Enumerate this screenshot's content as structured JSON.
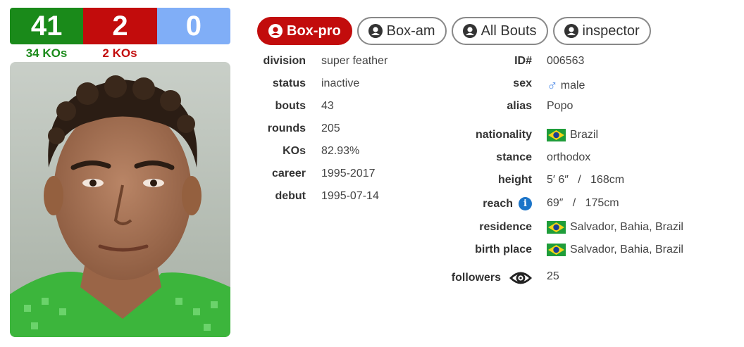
{
  "record": {
    "wins": "41",
    "losses": "2",
    "draws": "0",
    "wins_kos": "34 KOs",
    "losses_kos": "2 KOs"
  },
  "tabs": [
    {
      "label": "Box-pro",
      "active": true
    },
    {
      "label": "Box-am",
      "active": false
    },
    {
      "label": "All Bouts",
      "active": false
    },
    {
      "label": "inspector",
      "active": false
    }
  ],
  "left_info": [
    {
      "label": "division",
      "value": "super feather"
    },
    {
      "label": "status",
      "value": "inactive"
    },
    {
      "label": "bouts",
      "value": "43"
    },
    {
      "label": "rounds",
      "value": "205"
    },
    {
      "label": "KOs",
      "value": "82.93%"
    },
    {
      "label": "career",
      "value": "1995-2017"
    },
    {
      "label": "debut",
      "value": "1995-07-14"
    }
  ],
  "right_info": {
    "id": {
      "label": "ID#",
      "value": "006563"
    },
    "sex": {
      "label": "sex",
      "value": "male",
      "icon": "male-icon"
    },
    "alias": {
      "label": "alias",
      "value": "Popo"
    },
    "nationality": {
      "label": "nationality",
      "value": "Brazil",
      "icon": "brazil-flag-icon"
    },
    "stance": {
      "label": "stance",
      "value": "orthodox"
    },
    "height": {
      "label": "height",
      "value": "5′ 6″   /   168cm"
    },
    "reach": {
      "label": "reach",
      "value": "69″   /   175cm",
      "icon": "info-icon"
    },
    "residence": {
      "label": "residence",
      "value": "Salvador, Bahia, Brazil",
      "icon": "brazil-flag-icon"
    },
    "birth_place": {
      "label": "birth place",
      "value": "Salvador, Bahia, Brazil",
      "icon": "brazil-flag-icon"
    },
    "followers": {
      "label": "followers",
      "value": "25",
      "icon": "eye-icon"
    }
  },
  "colors": {
    "win": "#1a8a1a",
    "loss": "#c20c0c",
    "draw": "#80aef7",
    "active_tab": "#c20c0c",
    "info_icon": "#1b74c8",
    "male_icon": "#5b93e8"
  }
}
